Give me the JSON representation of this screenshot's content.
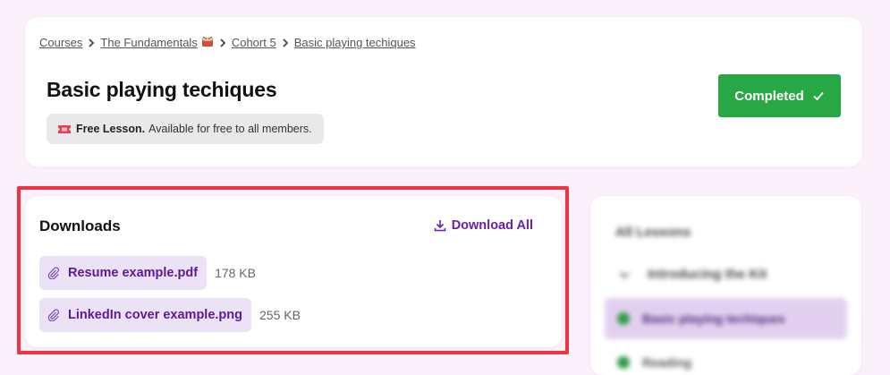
{
  "breadcrumb": [
    {
      "label": "Courses"
    },
    {
      "label": "The Fundamentals",
      "emoji": "drum"
    },
    {
      "label": "Cohort 5"
    },
    {
      "label": "Basic playing techiques"
    }
  ],
  "lesson": {
    "title": "Basic playing techiques",
    "badge_strong": "Free Lesson.",
    "badge_text": "Available for free to all members.",
    "badge_icon": "ticket-icon"
  },
  "actions": {
    "completed_label": "Completed",
    "completed_icon": "check-icon",
    "completed_color": "#28a745"
  },
  "downloads": {
    "title": "Downloads",
    "download_all_label": "Download All",
    "files": [
      {
        "name": "Resume example.pdf",
        "size": "178 KB"
      },
      {
        "name": "LinkedIn cover example.png",
        "size": "255 KB"
      }
    ]
  },
  "sidebar": {
    "title": "All Lessons",
    "module": "Introducing the Kit",
    "lessons": [
      {
        "label": "Basic playing techiques",
        "active": true
      },
      {
        "label": "Reading",
        "active": false
      }
    ]
  },
  "colors": {
    "accent": "#6a1fb0",
    "highlight": "#f23242",
    "page_bg": "#fbf1fb"
  }
}
